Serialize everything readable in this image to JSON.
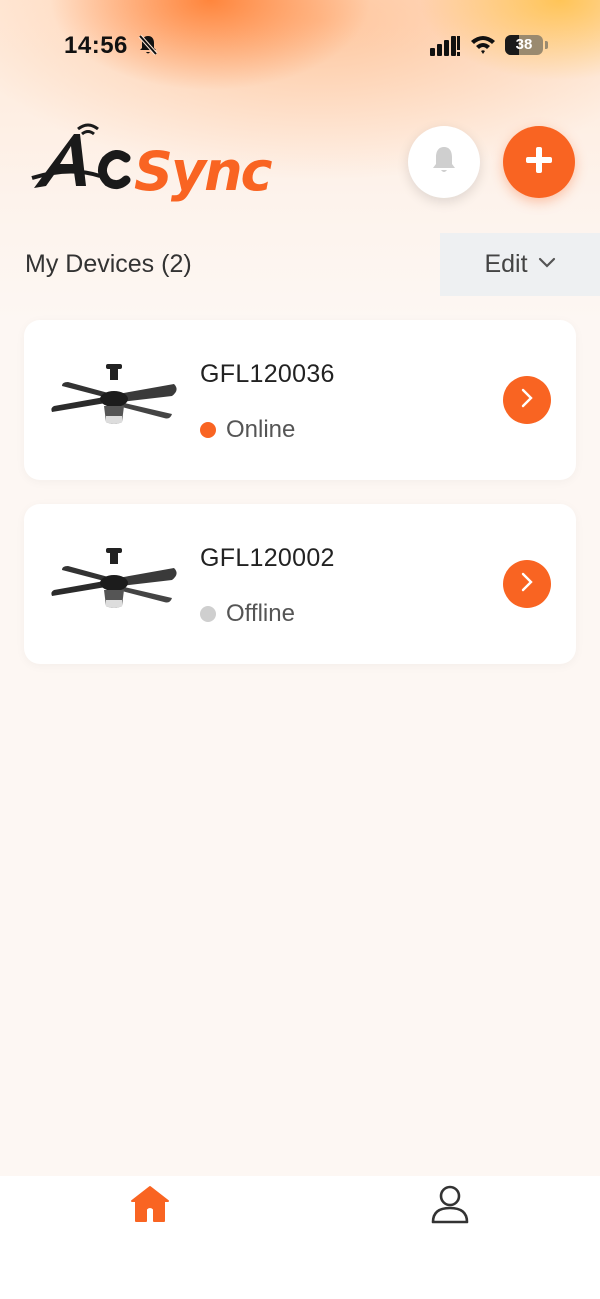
{
  "status_bar": {
    "time": "14:56",
    "battery_level": "38",
    "battery_fraction": 0.38,
    "icons": [
      "bell-slash-icon",
      "cellular-signal-icon",
      "wifi-icon",
      "battery-icon"
    ]
  },
  "header": {
    "logo_text": "AcSync",
    "logo_colors": {
      "ac": "#1a1a1a",
      "sync": "#f96422"
    },
    "notification_icon": "bell-icon",
    "add_icon": "plus-icon"
  },
  "devices_section": {
    "title": "My Devices (2)",
    "edit_label": "Edit",
    "edit_icon": "chevron-down-icon"
  },
  "devices": [
    {
      "name": "GFL120036",
      "status": "Online",
      "status_color": "#f96422",
      "image": "ceiling-fan-image"
    },
    {
      "name": "GFL120002",
      "status": "Offline",
      "status_color": "#cfcfcf",
      "image": "ceiling-fan-image"
    }
  ],
  "tab_bar": {
    "items": [
      {
        "icon": "home-icon",
        "active": true
      },
      {
        "icon": "user-icon",
        "active": false
      }
    ]
  },
  "colors": {
    "accent": "#f96422",
    "background": "#fdf7f3",
    "card": "#ffffff"
  }
}
